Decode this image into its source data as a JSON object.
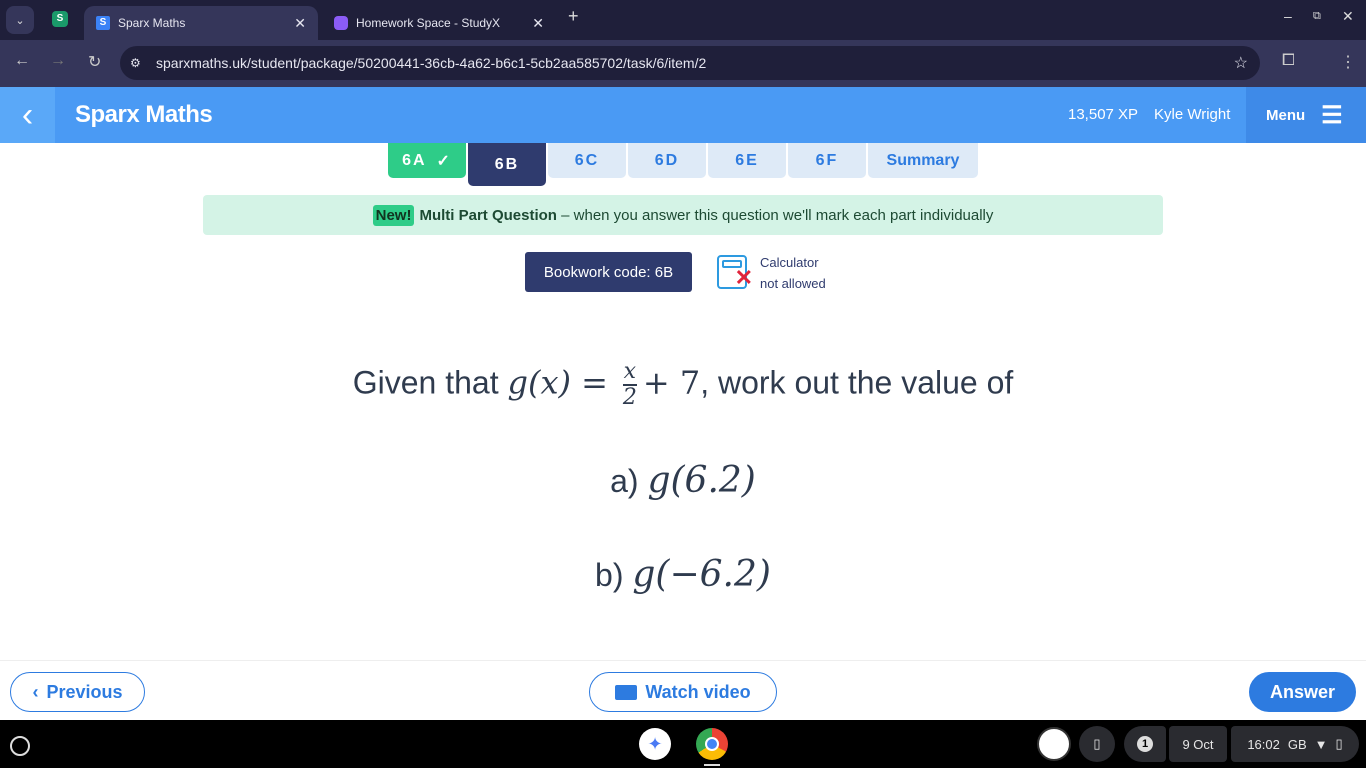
{
  "browser": {
    "tabs": [
      {
        "label": "Sparx Maths",
        "favicon": "S",
        "active": true
      },
      {
        "label": "Homework Space - StudyX",
        "active": false
      }
    ],
    "pinned_icon": "S",
    "url": "sparxmaths.uk/student/package/50200441-36cb-4a62-b6c1-5cb2aa585702/task/6/item/2"
  },
  "header": {
    "title": "Sparx Maths",
    "xp": "13,507 XP",
    "user": "Kyle Wright",
    "menu": "Menu"
  },
  "tasks": [
    {
      "label": "6A",
      "status": "complete"
    },
    {
      "label": "6B",
      "status": "active"
    },
    {
      "label": "6C"
    },
    {
      "label": "6D"
    },
    {
      "label": "6E"
    },
    {
      "label": "6F"
    },
    {
      "label": "Summary"
    }
  ],
  "banner": {
    "badge": "New!",
    "title": "Multi Part Question",
    "text": " – when you answer this question we'll mark each part individually"
  },
  "bookwork": "Bookwork code: 6B",
  "calculator": {
    "line1": "Calculator",
    "line2": "not allowed"
  },
  "question": {
    "intro": "Given that",
    "fn": "g(x) =",
    "num": "x",
    "den": "2",
    "tail": "+ 7",
    "rest": ", work out the value of",
    "parts": [
      {
        "label": "a)",
        "expr": "g(6.2)"
      },
      {
        "label": "b)",
        "expr": "g(−6.2)"
      }
    ]
  },
  "footer": {
    "previous": "Previous",
    "watch": "Watch video",
    "answer": "Answer"
  },
  "shelf": {
    "notifications": "1",
    "date": "9 Oct",
    "time": "16:02",
    "locale": "GB"
  },
  "colors": {
    "brand": "#4a9af4",
    "navy": "#2f3b6e",
    "green": "#2ecc88"
  }
}
